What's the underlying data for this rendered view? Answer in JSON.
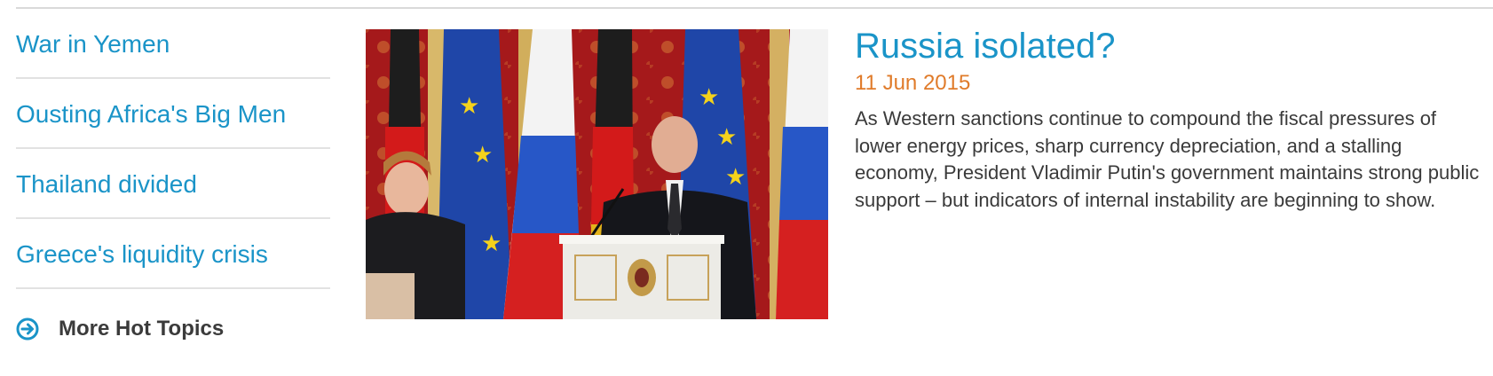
{
  "sidebar": {
    "topics": [
      {
        "label": "War in Yemen"
      },
      {
        "label": "Ousting Africa's Big Men"
      },
      {
        "label": "Thailand divided"
      },
      {
        "label": "Greece's liquidity crisis"
      }
    ],
    "more": {
      "label": "More Hot Topics",
      "icon": "arrow-circle-right-icon"
    }
  },
  "feature": {
    "image_icon": "press-conference-photo",
    "title": "Russia isolated?",
    "date": "11 Jun 2015",
    "summary": "As Western sanctions continue to compound the fiscal pressures of lower energy prices, sharp currency depreciation, and a stalling economy, President Vladimir Putin's government maintains strong public support – but indicators of internal instability are beginning to show."
  },
  "colors": {
    "link": "#1a94c8",
    "date": "#e07b2a",
    "body_text": "#3a3a3a",
    "divider": "#e2e2e2"
  }
}
